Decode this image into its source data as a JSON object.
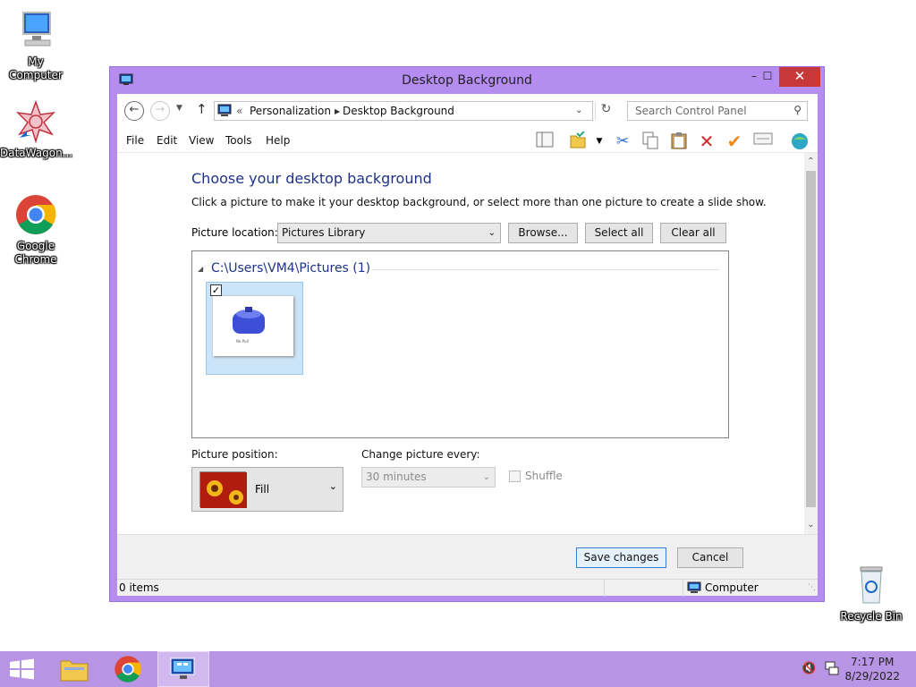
{
  "desktop": {
    "icons": [
      {
        "label": "My Computer"
      },
      {
        "label": "DataWagon..."
      },
      {
        "label": "Google Chrome"
      },
      {
        "label": "Recycle Bin"
      }
    ]
  },
  "window": {
    "title": "Desktop Background",
    "minimize": "–",
    "maximize": "☐",
    "close": "✕"
  },
  "address": {
    "chevrons": "«",
    "crumbs": [
      "Personalization",
      "Desktop Background"
    ],
    "search_placeholder": "Search Control Panel"
  },
  "menu": [
    "File",
    "Edit",
    "View",
    "Tools",
    "Help"
  ],
  "content": {
    "heading": "Choose your desktop background",
    "description": "Click a picture to make it your desktop background, or select more than one picture to create a slide show.",
    "picture_location_label": "Picture location:",
    "picture_location_value": "Pictures Library",
    "browse": "Browse...",
    "select_all": "Select all",
    "clear_all": "Clear all",
    "group_header": "C:\\Users\\VM4\\Pictures (1)",
    "thumb_caption": "No Pull",
    "picture_position_label": "Picture position:",
    "picture_position_value": "Fill",
    "change_every_label": "Change picture every:",
    "change_every_value": "30 minutes",
    "shuffle": "Shuffle"
  },
  "footer": {
    "save": "Save changes",
    "cancel": "Cancel"
  },
  "status": {
    "items": "0 items",
    "location": "Computer"
  },
  "taskbar": {
    "time": "7:17 PM",
    "date": "8/29/2022"
  },
  "colors": {
    "window_frame": "#b58cf0",
    "taskbar": "#b894e4",
    "heading": "#1e3287",
    "close": "#c7383a"
  }
}
